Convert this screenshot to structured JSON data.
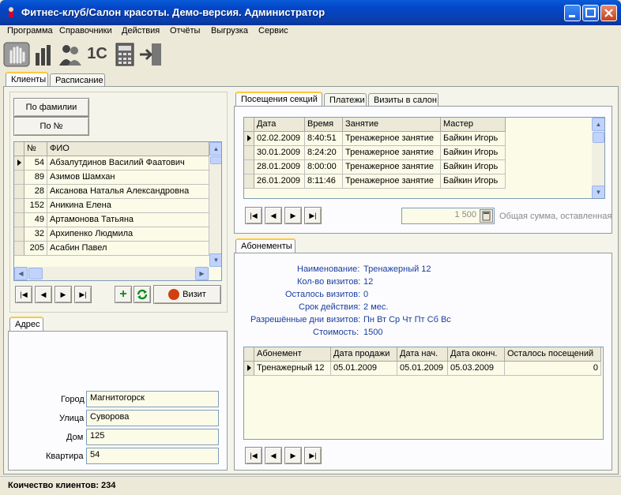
{
  "window": {
    "title": "Фитнес-клуб/Салон красоты. Демо-версия. Администратор"
  },
  "menu": [
    "Программа",
    "Справочники",
    "Действия",
    "Отчёты",
    "Выгрузка",
    "Сервис"
  ],
  "toolbar": {
    "tool5_label": "1С"
  },
  "main_tabs": [
    "Клиенты",
    "Расписание"
  ],
  "sort_buttons": {
    "by_surname": "По фамилии",
    "by_number": "По №"
  },
  "clients": {
    "columns": [
      "№",
      "ФИО"
    ],
    "rows": [
      [
        "54",
        "Абзалутдинов Василий Фаатович"
      ],
      [
        "89",
        "Азимов Шамхан"
      ],
      [
        "28",
        "Аксанова Наталья Александровна"
      ],
      [
        "152",
        "Аникина Елена"
      ],
      [
        "49",
        "Артамонова Татьяна"
      ],
      [
        "32",
        "Архипенко Людмила"
      ],
      [
        "205",
        "Асабин Павел"
      ]
    ]
  },
  "visit_button": "Визит",
  "address": {
    "tab": "Адрес",
    "city_label": "Город",
    "city": "Магнитогорск",
    "street_label": "Улица",
    "street": "Суворова",
    "house_label": "Дом",
    "house": "125",
    "apt_label": "Квартира",
    "apt": "54"
  },
  "right_tabs": [
    "Посещения секций",
    "Платежи",
    "Визиты в салон"
  ],
  "visits": {
    "columns": [
      "Дата",
      "Время",
      "Занятие",
      "Мастер"
    ],
    "rows": [
      [
        "02.02.2009",
        "8:40:51",
        "Тренажерное занятие",
        "Байкин Игорь"
      ],
      [
        "30.01.2009",
        "8:24:20",
        "Тренажерное занятие",
        "Байкин Игорь"
      ],
      [
        "28.01.2009",
        "8:00:00",
        "Тренажерное занятие",
        "Байкин Игорь"
      ],
      [
        "26.01.2009",
        "8:11:46",
        "Тренажерное занятие",
        "Байкин Игорь"
      ]
    ]
  },
  "total": {
    "value": "1 500",
    "label": "Общая сумма, оставленная"
  },
  "subscriptions": {
    "tab": "Абонементы",
    "name_label": "Наименование:",
    "name": "Тренажерный 12",
    "visits_label": "Кол-во визитов:",
    "visits": "12",
    "left_label": "Осталось визитов:",
    "left": "0",
    "term_label": "Срок действия:",
    "term": "2 мес.",
    "days_label": "Разрешённые дни визитов:",
    "days": "Пн Вт Ср Чт Пт Сб Вс",
    "cost_label": "Стоимость:",
    "cost": "1500",
    "columns": [
      "Абонемент",
      "Дата продажи",
      "Дата нач.",
      "Дата оконч.",
      "Осталось посещений"
    ],
    "rows": [
      [
        "Тренажерный 12",
        "05.01.2009",
        "05.01.2009",
        "05.03.2009",
        "0"
      ]
    ]
  },
  "status": {
    "text": "Коичество клиентов: 234"
  },
  "colors": {
    "accent_tab": "#ffc83c",
    "grid_bg": "#fbfbe8",
    "title_blue": "#0347c9"
  }
}
